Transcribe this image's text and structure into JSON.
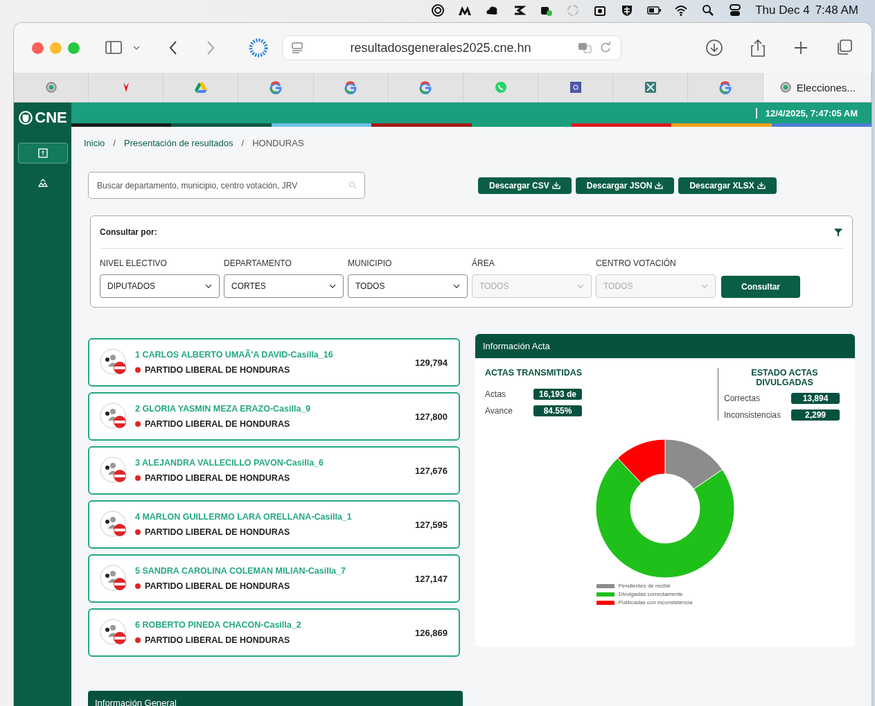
{
  "menubar": {
    "date": "Thu Dec 4",
    "time": "7:48 AM"
  },
  "browser": {
    "url": "resultadosgenerales2025.cne.hn",
    "tabs": [
      {
        "selected": false
      },
      {
        "selected": false
      },
      {
        "selected": false
      },
      {
        "selected": false
      },
      {
        "selected": false
      },
      {
        "selected": false
      },
      {
        "selected": false
      },
      {
        "selected": false
      },
      {
        "selected": false
      },
      {
        "selected": false
      },
      {
        "label": "Elecciones...",
        "selected": true
      }
    ]
  },
  "app": {
    "logo": "CNE",
    "datetime": "12/4/2025, 7:47:05 AM",
    "sidebar": [
      {
        "selected": true
      },
      {
        "selected": false
      }
    ]
  },
  "breadcrumb": {
    "separator": "/",
    "items": [
      {
        "label": "Inicio",
        "current": false
      },
      {
        "label": "Presentación de resultados",
        "current": false
      },
      {
        "label": "HONDURAS",
        "current": true
      }
    ]
  },
  "search": {
    "placeholder": "Buscar departamento, municipio, centro votación, JRV"
  },
  "downloads": [
    "Descargar CSV",
    "Descargar JSON",
    "Descargar XLSX"
  ],
  "filters": {
    "title": "Consultar por:",
    "button": "Consultar",
    "fields": [
      {
        "label": "NIVEL ELECTIVO",
        "value": "DIPUTADOS",
        "disabled": false
      },
      {
        "label": "DEPARTAMENTO",
        "value": "CORTES",
        "disabled": false
      },
      {
        "label": "MUNICIPIO",
        "value": "TODOS",
        "disabled": false
      },
      {
        "label": "ÁREA",
        "value": "TODOS",
        "disabled": true
      },
      {
        "label": "CENTRO VOTACIÓN",
        "value": "TODOS",
        "disabled": true
      }
    ]
  },
  "candidates": [
    {
      "name": "1 CARLOS ALBERTO UMAÃ'A DAVID-Casilla_16",
      "party": "PARTIDO LIBERAL DE HONDURAS",
      "color": "#e02424",
      "votes": "129,794"
    },
    {
      "name": "2 GLORIA YASMIN MEZA ERAZO-Casilla_9",
      "party": "PARTIDO LIBERAL DE HONDURAS",
      "color": "#e02424",
      "votes": "127,800"
    },
    {
      "name": "3 ALEJANDRA VALLECILLO PAVON-Casilla_6",
      "party": "PARTIDO LIBERAL DE HONDURAS",
      "color": "#e02424",
      "votes": "127,676"
    },
    {
      "name": "4 MARLON GUILLERMO LARA ORELLANA-Casilla_1",
      "party": "PARTIDO LIBERAL DE HONDURAS",
      "color": "#e02424",
      "votes": "127,595"
    },
    {
      "name": "5 SANDRA CAROLINA COLEMAN MILIAN-Casilla_7",
      "party": "PARTIDO LIBERAL DE HONDURAS",
      "color": "#e02424",
      "votes": "127,147"
    },
    {
      "name": "6 ROBERTO PINEDA CHACON-Casilla_2",
      "party": "PARTIDO LIBERAL DE HONDURAS",
      "color": "#e02424",
      "votes": "126,869"
    }
  ],
  "acta": {
    "title": "Información Acta",
    "transmitidas": {
      "heading": "ACTAS TRANSMITIDAS",
      "rows": [
        {
          "label": "Actas",
          "value": "16,193 de"
        },
        {
          "label": "Avance",
          "value": "84.55%"
        }
      ]
    },
    "estado": {
      "heading": "ESTADO ACTAS DIVULGADAS",
      "rows": [
        {
          "label": "Correctas",
          "value": "13,894"
        },
        {
          "label": "Inconsistencias",
          "value": "2,299"
        }
      ]
    },
    "legend": [
      {
        "label": "Pendientes de recibir",
        "color": "#8c8c8c"
      },
      {
        "label": "Divulgadas correctamente",
        "color": "#1fc01a"
      },
      {
        "label": "Publicadas con inconsistencia",
        "color": "#ff0000"
      }
    ]
  },
  "general": {
    "title": "Información General"
  }
}
